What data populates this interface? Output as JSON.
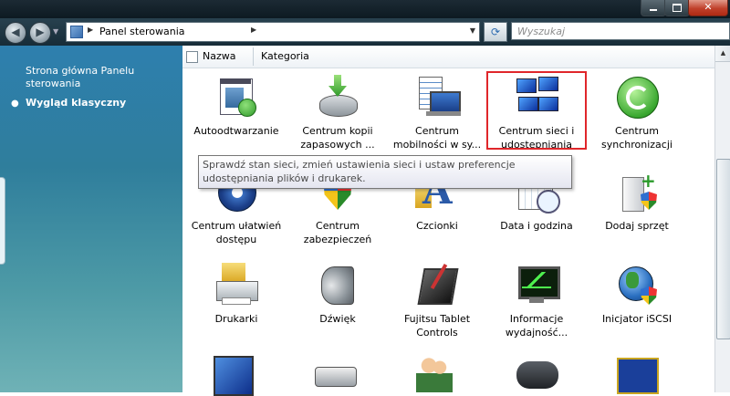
{
  "address": {
    "crumb": "Panel sterowania",
    "search_placeholder": "Wyszukaj"
  },
  "sidebar": {
    "home_link": "Strona główna Panelu sterowania",
    "classic_view": "Wygląd klasyczny"
  },
  "header": {
    "col_name": "Nazwa",
    "col_category": "Kategoria"
  },
  "items": [
    {
      "label": "Autoodtwarzanie"
    },
    {
      "label": "Centrum kopii zapasowych ..."
    },
    {
      "label": "Centrum mobilności w sy..."
    },
    {
      "label": "Centrum sieci i udostępniania"
    },
    {
      "label": "Centrum synchronizacji"
    },
    {
      "label": "Centrum ułatwień dostępu"
    },
    {
      "label": "Centrum zabezpieczeń"
    },
    {
      "label": "Czcionki"
    },
    {
      "label": "Data i godzina"
    },
    {
      "label": "Dodaj sprzęt"
    },
    {
      "label": "Drukarki"
    },
    {
      "label": "Dźwięk"
    },
    {
      "label": "Fujitsu Tablet Controls"
    },
    {
      "label": "Informacje wydajność..."
    },
    {
      "label": "Inicjator iSCSI"
    }
  ],
  "tooltip": "Sprawdź stan sieci, zmień ustawienia sieci i ustaw preferencje udostępniania plików i drukarek.",
  "selected_item": "Centrum sieci i udostępniania",
  "colors": {
    "selection_border": "#e0262a",
    "sidebar_top": "#2e7fae"
  }
}
